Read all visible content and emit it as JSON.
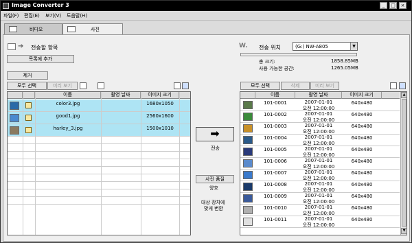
{
  "window": {
    "title": "Image Converter 3",
    "minimize": "_",
    "maximize": "□",
    "close": "×"
  },
  "menu": [
    "파일(F)",
    "편집(E)",
    "보기(V)",
    "도움말(H)"
  ],
  "tabs": [
    {
      "label": "비디오",
      "active": false
    },
    {
      "label": "사진",
      "active": true
    }
  ],
  "left": {
    "heading": "전송할 항목",
    "add_button": "목록에 추가",
    "remove_button": "제거",
    "select_all": "모두 선택",
    "preview": "미리 보기",
    "columns": [
      "이름",
      "촬영 날짜",
      "이미지 크기"
    ],
    "rows": [
      {
        "name": "color3.jpg",
        "date": "",
        "size": "1680x1050",
        "thumb": "#2a6aa8"
      },
      {
        "name": "good1.jpg",
        "date": "",
        "size": "2560x1600",
        "thumb": "#4a8ad0"
      },
      {
        "name": "harley_3.jpg",
        "date": "",
        "size": "1500x1010",
        "thumb": "#8a7a60"
      }
    ]
  },
  "middle": {
    "transfer_label": "전송",
    "quality_button": "사진 품질",
    "quality_value": "양호",
    "fit_label_1": "대상 장치에",
    "fit_label_2": "맞게 변환"
  },
  "right": {
    "heading": "전송 위치",
    "device": "(G:) NW-A805",
    "total_label": "총 크기:",
    "total_value": "1858.85MB",
    "free_label": "사용 가능한 공간:",
    "free_value": "1265.05MB",
    "select_all": "모두 선택",
    "delete": "삭제",
    "preview": "미리 보기",
    "columns": [
      "이름",
      "촬영 날짜",
      "이미지 크기"
    ],
    "rows": [
      {
        "name": "101-0001",
        "date1": "2007-01-01",
        "date2": "오전 12:00:00",
        "size": "640x480",
        "thumb": "#5a7a4a"
      },
      {
        "name": "101-0002",
        "date1": "2007-01-01",
        "date2": "오전 12:00:00",
        "size": "640x480",
        "thumb": "#3a8a3a"
      },
      {
        "name": "101-0003",
        "date1": "2007-01-01",
        "date2": "오전 12:00:00",
        "size": "640x480",
        "thumb": "#c89028"
      },
      {
        "name": "101-0004",
        "date1": "2007-01-01",
        "date2": "오전 12:00:00",
        "size": "640x480",
        "thumb": "#2a5a8a"
      },
      {
        "name": "101-0005",
        "date1": "2007-01-01",
        "date2": "오전 12:00:00",
        "size": "640x480",
        "thumb": "#2a3a7a"
      },
      {
        "name": "101-0006",
        "date1": "2007-01-01",
        "date2": "오전 12:00:00",
        "size": "640x480",
        "thumb": "#5a8acc"
      },
      {
        "name": "101-0007",
        "date1": "2007-01-01",
        "date2": "오전 12:00:00",
        "size": "640x480",
        "thumb": "#3a7acc"
      },
      {
        "name": "101-0008",
        "date1": "2007-01-01",
        "date2": "오전 12:00:00",
        "size": "640x480",
        "thumb": "#1a3a6a"
      },
      {
        "name": "101-0009",
        "date1": "2007-01-01",
        "date2": "오전 12:00:00",
        "size": "640x480",
        "thumb": "#3a5a9a"
      },
      {
        "name": "101-0010",
        "date1": "2007-01-01",
        "date2": "오전 12:00:00",
        "size": "640x480",
        "thumb": "#b0b0b0"
      },
      {
        "name": "101-0011",
        "date1": "2007-01-01",
        "date2": "오전 12:00:00",
        "size": "640x480",
        "thumb": "#e0e0e0"
      }
    ]
  },
  "colors": {
    "selected_row": "#aee4f4",
    "title_bar": "#000000",
    "tab_area": "#efefef"
  }
}
